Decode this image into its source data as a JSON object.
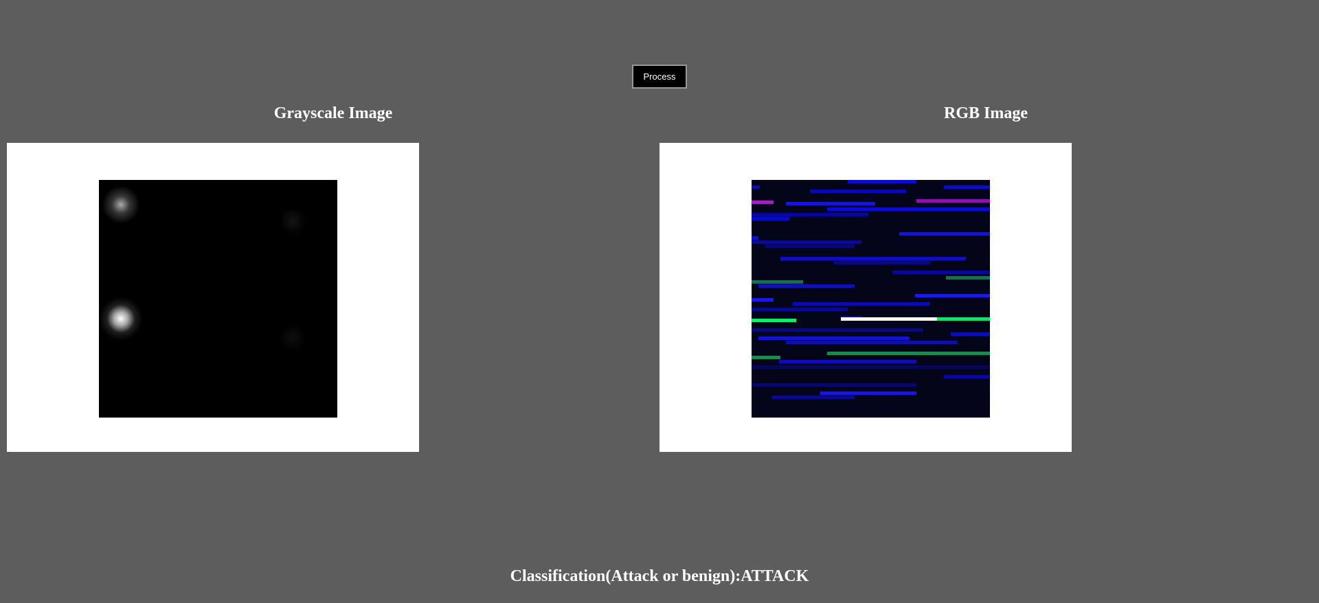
{
  "toolbar": {
    "process_label": "Process"
  },
  "panels": {
    "grayscale": {
      "title": "Grayscale Image"
    },
    "rgb": {
      "title": "RGB Image"
    }
  },
  "result": {
    "label": "Classification(Attack or benign):",
    "value": "ATTACK"
  },
  "colors": {
    "background": "#5d5d5d",
    "panel": "#ffffff",
    "button_bg": "#000000",
    "text": "#ffffff"
  }
}
